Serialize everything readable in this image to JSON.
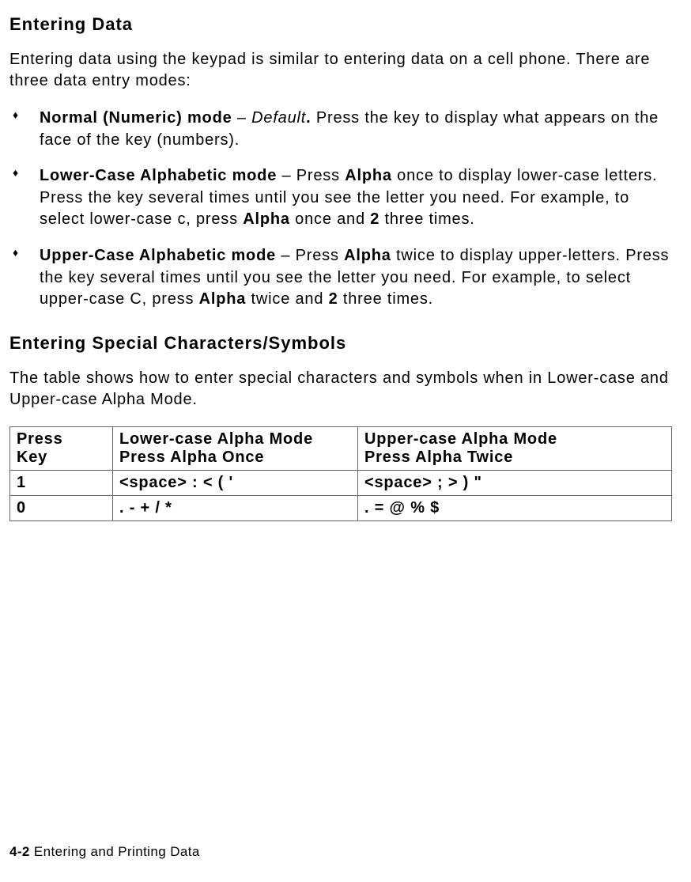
{
  "section1": {
    "heading": "Entering Data",
    "intro": "Entering data using the keypad is similar to entering data on a cell phone.  There are three data entry modes:",
    "modes": [
      {
        "title": "Normal (Numeric) mode",
        "sep": " – ",
        "default_label": "Default",
        "stop": ".  ",
        "desc": "Press the key to display what appears on the face of the key (numbers)."
      },
      {
        "title": "Lower-Case Alphabetic mode",
        "sep": " – ",
        "pre": "Press ",
        "alpha": "Alpha",
        "mid1": " once to display lower-case letters.  Press the key several times until you see the letter you need.  For example, to select lower-case c, press ",
        "alpha2": "Alpha",
        "mid2": " once and ",
        "key": "2",
        "tail": " three times."
      },
      {
        "title": "Upper-Case Alphabetic mode",
        "sep": " – ",
        "pre": "Press ",
        "alpha": "Alpha",
        "mid1": " twice to display upper-letters.  Press the key several times until you see the letter you need.  For example, to select upper-case C, press ",
        "alpha2": "Alpha",
        "mid2": " twice and ",
        "key": "2",
        "tail": " three times."
      }
    ]
  },
  "section2": {
    "heading": "Entering Special Characters/Symbols",
    "intro": "The table shows how to enter special characters and symbols when in Lower-case and Upper-case Alpha Mode.",
    "table": {
      "headers": {
        "col1_l1": "Press",
        "col1_l2": "Key",
        "col2_l1": "Lower-case Alpha Mode",
        "col2_l2": "Press Alpha Once",
        "col3_l1": "Upper-case Alpha Mode",
        "col3_l2": "Press Alpha Twice"
      },
      "rows": [
        {
          "key": "1",
          "lower": "<space>  :  <  (  '",
          "upper": "<space>  ;  >  )  \""
        },
        {
          "key": "0",
          "lower": ".  -  +  /  *",
          "upper": ".  =  @  %  $"
        }
      ]
    }
  },
  "footer": {
    "page": "4-2",
    "title": "  Entering and Printing Data"
  }
}
